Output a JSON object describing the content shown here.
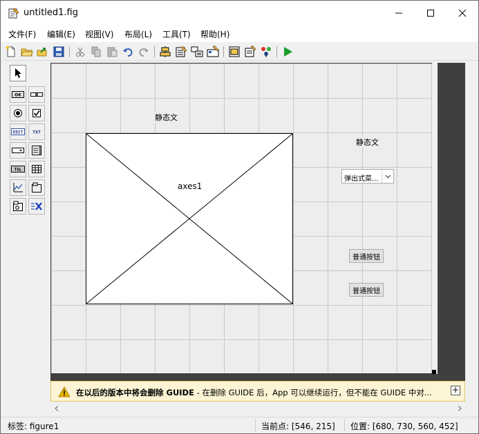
{
  "window": {
    "title": "untitled1.fig",
    "controls": [
      "minimize-icon",
      "maximize-icon",
      "close-icon"
    ]
  },
  "menu": [
    {
      "label": "文件(F)"
    },
    {
      "label": "编辑(E)"
    },
    {
      "label": "视图(V)"
    },
    {
      "label": "布局(L)"
    },
    {
      "label": "工具(T)"
    },
    {
      "label": "帮助(H)"
    }
  ],
  "toolbar": [
    "new-icon",
    "open-icon",
    "export-icon",
    "save-icon",
    "cut-icon",
    "copy-icon",
    "paste-icon",
    "undo-icon",
    "redo-icon",
    "align-icon",
    "menu-editor-icon",
    "tab-order-icon",
    "toolbar-editor-icon",
    "editor-icon",
    "property-inspector-icon",
    "object-browser-icon",
    "run-icon"
  ],
  "palette": {
    "items": [
      {
        "icon": "select-arrow-icon",
        "text": ""
      },
      {
        "icon": "push-button-icon",
        "text": "OK"
      },
      {
        "icon": "slider-icon",
        "text": ""
      },
      {
        "icon": "radio-button-icon",
        "text": ""
      },
      {
        "icon": "checkbox-icon",
        "text": ""
      },
      {
        "icon": "edit-text-icon",
        "text": "EDIT"
      },
      {
        "icon": "static-text-icon",
        "text": "TXT"
      },
      {
        "icon": "popup-menu-icon",
        "text": ""
      },
      {
        "icon": "listbox-icon",
        "text": ""
      },
      {
        "icon": "toggle-button-icon",
        "text": "TGL"
      },
      {
        "icon": "table-icon",
        "text": ""
      },
      {
        "icon": "axes-icon",
        "text": ""
      },
      {
        "icon": "panel-icon",
        "text": ""
      },
      {
        "icon": "button-group-icon",
        "text": ""
      },
      {
        "icon": "activex-icon",
        "text": ""
      }
    ]
  },
  "canvas": {
    "static_text_1": "静态文",
    "static_text_2": "静态文",
    "axes_label": "axes1",
    "popup_text": "弹出式菜...",
    "push_button_1": "普通按钮",
    "push_button_2": "普通按钮"
  },
  "warning": {
    "bold": "在以后的版本中将会删除 GUIDE",
    "rest": " - 在删除 GUIDE 后，App 可以继续运行，但不能在 GUIDE 中对..."
  },
  "status": {
    "tag": "标签: figure1",
    "current_point": "当前点:  [546, 215]",
    "position": "位置: [680, 730, 560, 452]"
  },
  "colors": {
    "canvas_bg": "#ededed",
    "grid": "#c9c9c9",
    "warning_bg": "#fcf4d4",
    "run_green": "#1a9c2d"
  }
}
